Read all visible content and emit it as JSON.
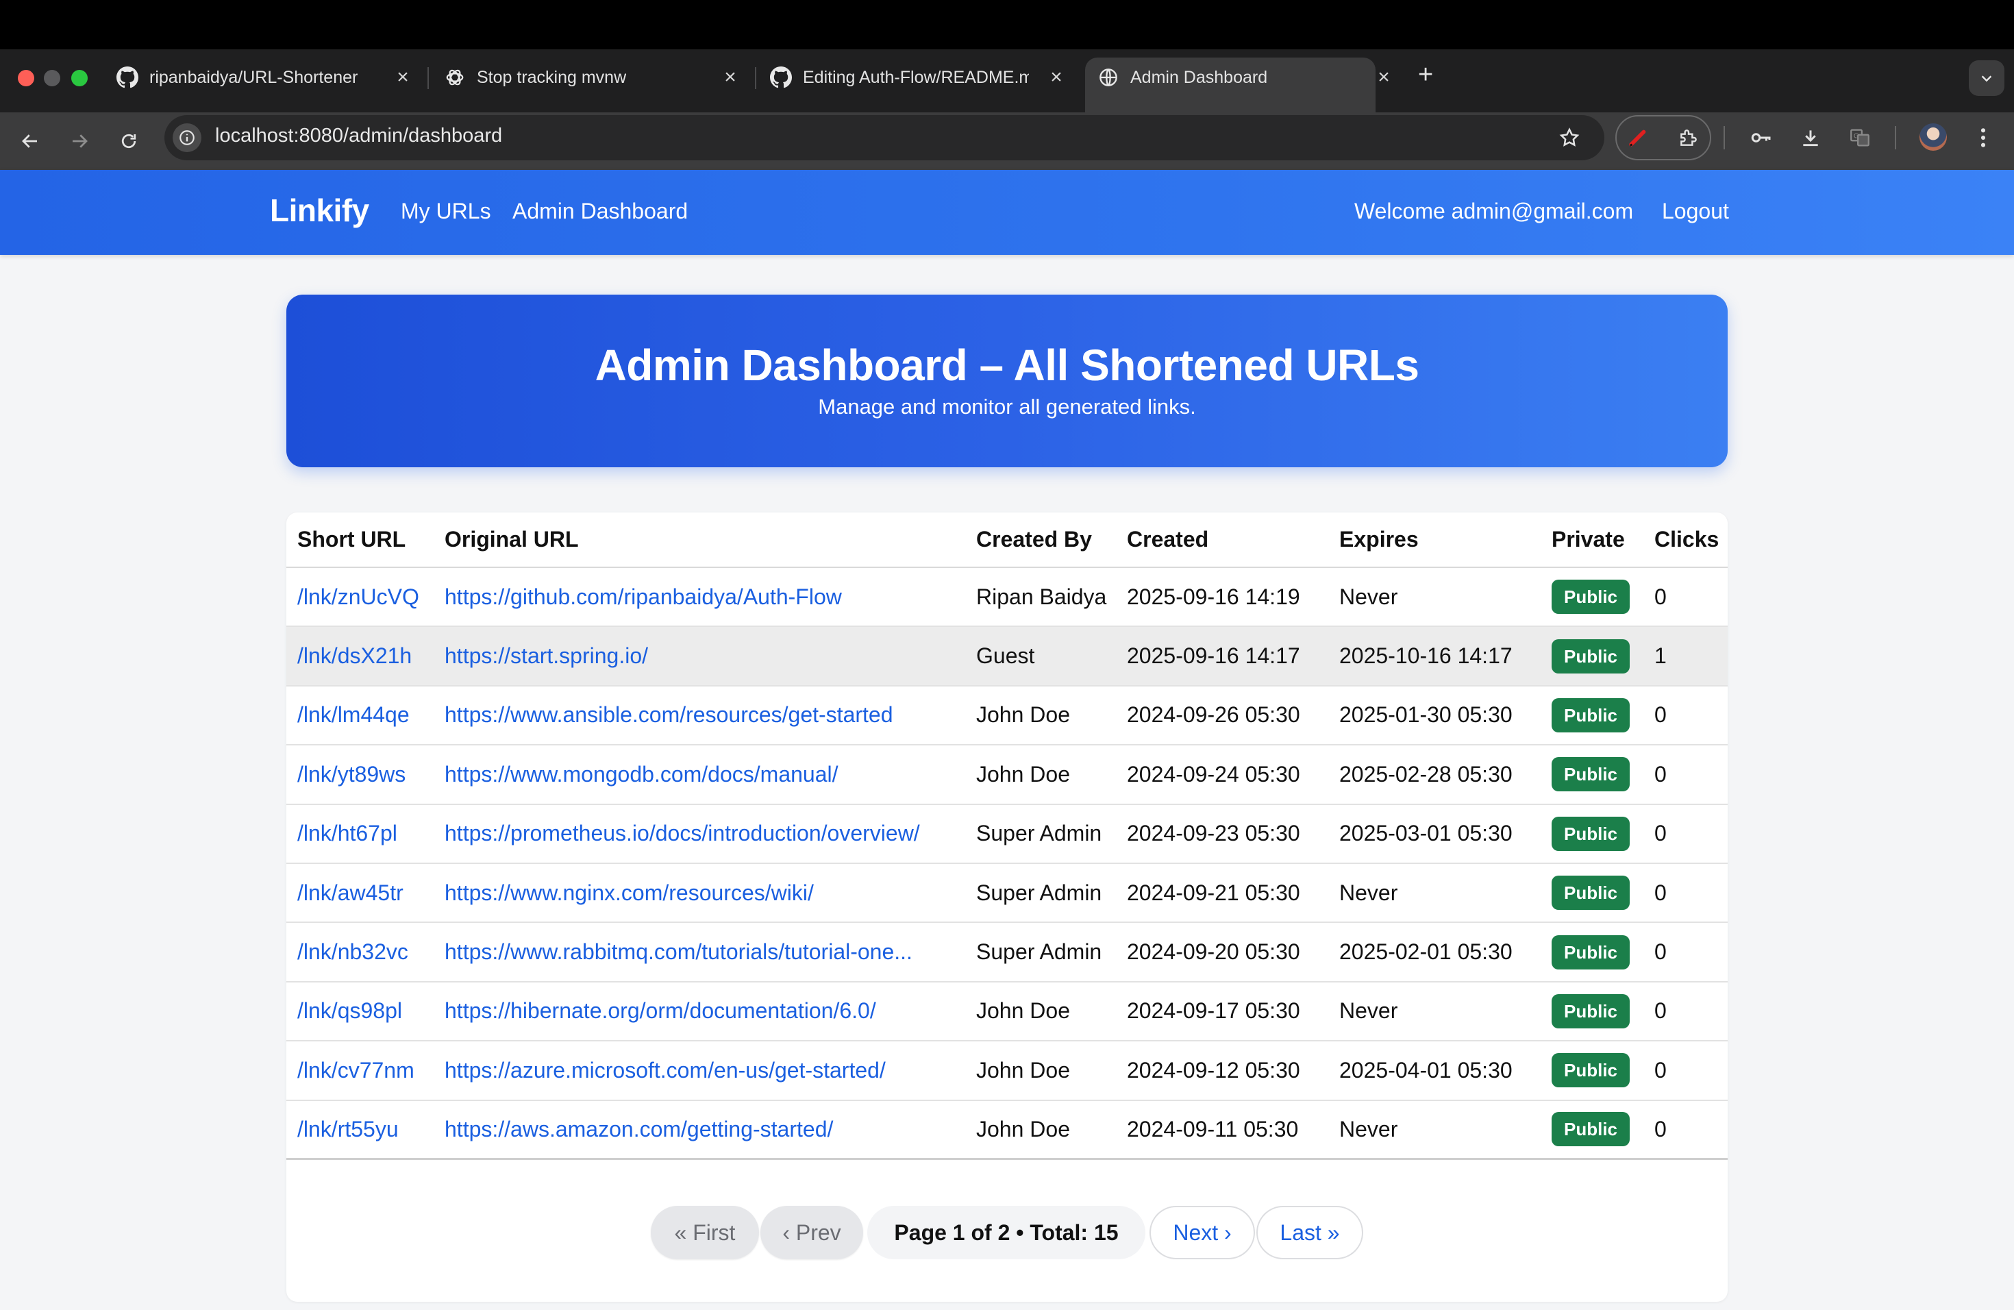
{
  "browser": {
    "tabs": [
      {
        "title": "ripanbaidya/URL-Shortener",
        "icon": "github-icon"
      },
      {
        "title": "Stop tracking mvnw",
        "icon": "openai-icon"
      },
      {
        "title": "Editing Auth-Flow/README.m",
        "icon": "github-icon"
      },
      {
        "title": "Admin Dashboard",
        "icon": "globe-icon",
        "active": true
      }
    ],
    "url": "localhost:8080/admin/dashboard"
  },
  "nav": {
    "brand": "Linkify",
    "links": [
      "My URLs",
      "Admin Dashboard"
    ],
    "welcome": "Welcome admin@gmail.com",
    "logout": "Logout",
    "color": "#2f74ee"
  },
  "hero": {
    "title": "Admin Dashboard – All Shortened URLs",
    "subtitle": "Manage and monitor all generated links."
  },
  "table": {
    "headers": [
      "Short URL",
      "Original URL",
      "Created By",
      "Created",
      "Expires",
      "Private",
      "Clicks"
    ],
    "rows": [
      {
        "short": "/lnk/znUcVQ",
        "original": "https://github.com/ripanbaidya/Auth-Flow",
        "by": "Ripan Baidya",
        "created": "2025-09-16 14:19",
        "expires": "Never",
        "private": "Public",
        "clicks": "0"
      },
      {
        "short": "/lnk/dsX21h",
        "original": "https://start.spring.io/",
        "by": "Guest",
        "created": "2025-09-16 14:17",
        "expires": "2025-10-16 14:17",
        "private": "Public",
        "clicks": "1"
      },
      {
        "short": "/lnk/lm44qe",
        "original": "https://www.ansible.com/resources/get-started",
        "by": "John Doe",
        "created": "2024-09-26 05:30",
        "expires": "2025-01-30 05:30",
        "private": "Public",
        "clicks": "0"
      },
      {
        "short": "/lnk/yt89ws",
        "original": "https://www.mongodb.com/docs/manual/",
        "by": "John Doe",
        "created": "2024-09-24 05:30",
        "expires": "2025-02-28 05:30",
        "private": "Public",
        "clicks": "0"
      },
      {
        "short": "/lnk/ht67pl",
        "original": "https://prometheus.io/docs/introduction/overview/",
        "by": "Super Admin",
        "created": "2024-09-23 05:30",
        "expires": "2025-03-01 05:30",
        "private": "Public",
        "clicks": "0"
      },
      {
        "short": "/lnk/aw45tr",
        "original": "https://www.nginx.com/resources/wiki/",
        "by": "Super Admin",
        "created": "2024-09-21 05:30",
        "expires": "Never",
        "private": "Public",
        "clicks": "0"
      },
      {
        "short": "/lnk/nb32vc",
        "original": "https://www.rabbitmq.com/tutorials/tutorial-one...",
        "by": "Super Admin",
        "created": "2024-09-20 05:30",
        "expires": "2025-02-01 05:30",
        "private": "Public",
        "clicks": "0"
      },
      {
        "short": "/lnk/qs98pl",
        "original": "https://hibernate.org/orm/documentation/6.0/",
        "by": "John Doe",
        "created": "2024-09-17 05:30",
        "expires": "Never",
        "private": "Public",
        "clicks": "0"
      },
      {
        "short": "/lnk/cv77nm",
        "original": "https://azure.microsoft.com/en-us/get-started/",
        "by": "John Doe",
        "created": "2024-09-12 05:30",
        "expires": "2025-04-01 05:30",
        "private": "Public",
        "clicks": "0"
      },
      {
        "short": "/lnk/rt55yu",
        "original": "https://aws.amazon.com/getting-started/",
        "by": "John Doe",
        "created": "2024-09-11 05:30",
        "expires": "Never",
        "private": "Public",
        "clicks": "0"
      }
    ]
  },
  "pagination": {
    "first": "« First",
    "prev": "‹ Prev",
    "info": "Page 1 of 2 • Total: 15",
    "next": "Next ›",
    "last": "Last »"
  }
}
